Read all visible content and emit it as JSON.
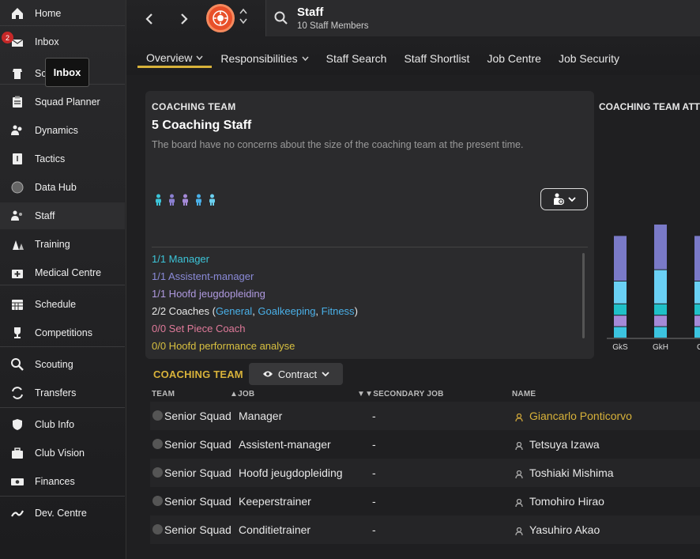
{
  "sidebar": {
    "items": [
      {
        "label": "Home",
        "icon": "home-icon"
      },
      {
        "label": "Inbox",
        "icon": "inbox-icon",
        "badge": "2"
      },
      {
        "label": "Sc",
        "icon": "squad-icon"
      },
      {
        "label": "Squad Planner",
        "icon": "clipboard-icon"
      },
      {
        "label": "Dynamics",
        "icon": "dynamics-icon"
      },
      {
        "label": "Tactics",
        "icon": "tactics-icon"
      },
      {
        "label": "Data Hub",
        "icon": "data-hub-icon"
      },
      {
        "label": "Staff",
        "icon": "staff-icon"
      },
      {
        "label": "Training",
        "icon": "training-icon"
      },
      {
        "label": "Medical Centre",
        "icon": "medical-icon"
      },
      {
        "label": "Schedule",
        "icon": "calendar-icon"
      },
      {
        "label": "Competitions",
        "icon": "trophy-icon"
      },
      {
        "label": "Scouting",
        "icon": "search-icon"
      },
      {
        "label": "Transfers",
        "icon": "transfer-icon"
      },
      {
        "label": "Club Info",
        "icon": "shield-icon"
      },
      {
        "label": "Club Vision",
        "icon": "briefcase-icon"
      },
      {
        "label": "Finances",
        "icon": "money-icon"
      },
      {
        "label": "Dev. Centre",
        "icon": "dev-centre-icon"
      }
    ],
    "tooltip": "Inbox"
  },
  "header": {
    "title": "Staff",
    "subtitle": "10 Staff Members",
    "tabs": [
      {
        "label": "Overview",
        "dropdown": true
      },
      {
        "label": "Responsibilities",
        "dropdown": true
      },
      {
        "label": "Staff Search"
      },
      {
        "label": "Staff Shortlist"
      },
      {
        "label": "Job Centre"
      },
      {
        "label": "Job Security"
      }
    ]
  },
  "coaching_panel": {
    "heading": "COACHING TEAM",
    "title": "5 Coaching Staff",
    "description": "The board have no concerns about the size of the coaching team at the present time.",
    "people_colors": [
      "#3cc4d8",
      "#8a7fd0",
      "#a58ad8",
      "#4ab0e8",
      "#6ad0f0"
    ],
    "roles": [
      {
        "text": "1/1 Manager",
        "color": "#3cc4d8"
      },
      {
        "text": "1/1 Assistent-manager",
        "color": "#8a8ad8"
      },
      {
        "text": "1/1 Hoofd jeugdopleiding",
        "color": "#b09ae0"
      },
      {
        "text": "0/0 Set Piece Coach",
        "color": "#e07a9a"
      },
      {
        "text": "0/0 Hoofd performance analyse",
        "color": "#d8c040"
      }
    ],
    "coaches_line": {
      "prefix": "2/2 Coaches (",
      "links": [
        "General",
        "Goalkeeping",
        "Fitness"
      ],
      "sep": ", ",
      "suffix": ")"
    }
  },
  "chart_data": {
    "type": "bar",
    "title": "COACHING TEAM ATT",
    "categories": [
      "GkS",
      "GkH",
      "Gi"
    ],
    "series": [
      {
        "color": "#3cc4e0",
        "values": [
          2,
          2,
          2
        ]
      },
      {
        "color": "#a58ad8",
        "values": [
          2,
          2,
          2
        ]
      },
      {
        "color": "#20c0c8",
        "values": [
          2,
          2,
          2
        ]
      },
      {
        "color": "#6ad0f4",
        "values": [
          4,
          6,
          4
        ]
      },
      {
        "color": "#7a7ac8",
        "values": [
          8,
          8,
          8
        ]
      }
    ]
  },
  "table": {
    "section_title": "COACHING TEAM",
    "filter_label": "Contract",
    "columns": [
      "TEAM",
      "JOB",
      "SECONDARY JOB",
      "NAME"
    ],
    "rows": [
      {
        "team": "Senior Squad",
        "job": "Manager",
        "secondary": "-",
        "name": "Giancarlo Ponticorvo",
        "highlight": true
      },
      {
        "team": "Senior Squad",
        "job": "Assistent-manager",
        "secondary": "-",
        "name": "Tetsuya Izawa"
      },
      {
        "team": "Senior Squad",
        "job": "Hoofd jeugdopleiding",
        "secondary": "-",
        "name": "Toshiaki Mishima"
      },
      {
        "team": "Senior Squad",
        "job": "Keeperstrainer",
        "secondary": "-",
        "name": "Tomohiro Hirao"
      },
      {
        "team": "Senior Squad",
        "job": "Conditietrainer",
        "secondary": "-",
        "name": "Yasuhiro Akao"
      }
    ]
  }
}
